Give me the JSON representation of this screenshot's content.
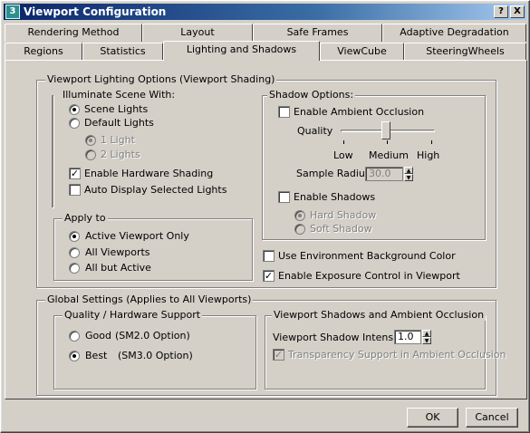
{
  "window": {
    "title": "Viewport Configuration",
    "help_label": "?",
    "close_label": "X",
    "app_icon_label": "3"
  },
  "tabs": {
    "row1": [
      "Rendering Method",
      "Layout",
      "Safe Frames",
      "Adaptive Degradation"
    ],
    "row2": [
      "Regions",
      "Statistics",
      "Lighting and Shadows",
      "ViewCube",
      "SteeringWheels"
    ],
    "active": "Lighting and Shadows"
  },
  "lighting": {
    "group_label": "Viewport Lighting Options (Viewport Shading)",
    "illuminate": {
      "label": "Illuminate Scene With:",
      "scene_lights": "Scene Lights",
      "default_lights": "Default Lights",
      "one_light": "1 Light",
      "two_lights": "2 Lights",
      "hardware_shading": "Enable Hardware Shading",
      "auto_display": "Auto Display Selected Lights",
      "selected": "Scene Lights",
      "hardware_shading_checked": true,
      "auto_display_checked": false
    },
    "apply_to": {
      "label": "Apply to",
      "options": [
        "Active Viewport Only",
        "All Viewports",
        "All but Active"
      ],
      "selected": "Active Viewport Only"
    },
    "shadow": {
      "label": "Shadow Options:",
      "ambient_occlusion": "Enable Ambient Occlusion",
      "ambient_occlusion_checked": false,
      "quality_label": "Quality",
      "quality_levels": [
        "Low",
        "Medium",
        "High"
      ],
      "quality_value": "Medium",
      "sample_radius_label": "Sample Radius",
      "sample_radius_value": "30.0",
      "enable_shadows": "Enable Shadows",
      "enable_shadows_checked": false,
      "hard_shadow": "Hard Shadow",
      "soft_shadow": "Soft Shadow"
    },
    "env_bg": "Use Environment Background Color",
    "env_bg_checked": false,
    "exposure": "Enable Exposure Control in Viewport",
    "exposure_checked": true
  },
  "global": {
    "group_label": "Global Settings (Applies to All Viewports)",
    "quality": {
      "label": "Quality / Hardware Support",
      "good": "Good",
      "good_option": "(SM2.0 Option)",
      "best": "Best",
      "best_option": "(SM3.0 Option)",
      "selected": "Best"
    },
    "vp_shadows": {
      "label": "Viewport Shadows and Ambient Occlusion",
      "intensity_label": "Viewport Shadow Intensity",
      "intensity_value": "1.0",
      "transparency_label": "Transparency Support in Ambient Occlusion",
      "transparency_checked": true
    }
  },
  "buttons": {
    "ok": "OK",
    "cancel": "Cancel"
  },
  "glyphs": {
    "check": "✓",
    "spin_up": "▲",
    "spin_down": "▼"
  }
}
